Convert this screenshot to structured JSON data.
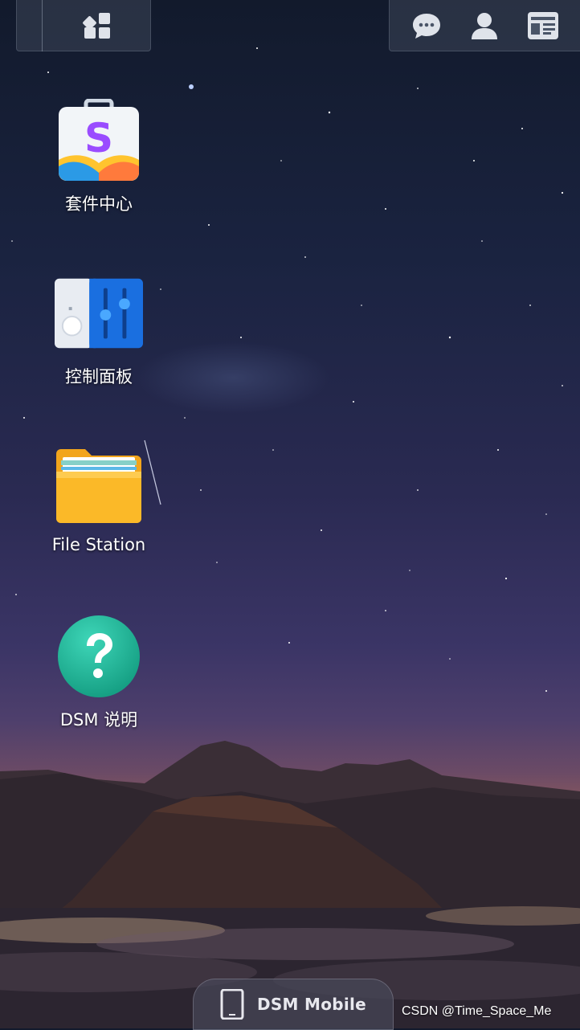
{
  "topbar": {
    "left_icon": "main-menu-grid-icon",
    "right_icons": [
      "chat-bubble-icon",
      "user-icon",
      "widgets-panel-icon"
    ]
  },
  "desktop": {
    "apps": [
      {
        "label": "套件中心",
        "icon": "package-center-icon"
      },
      {
        "label": "控制面板",
        "icon": "control-panel-icon"
      },
      {
        "label": "File Station",
        "icon": "folder-icon"
      },
      {
        "label": "DSM 说明",
        "icon": "help-question-icon"
      }
    ]
  },
  "footer": {
    "mobile_label": "DSM Mobile",
    "mobile_icon": "mobile-device-icon"
  },
  "watermark": "CSDN @Time_Space_Me",
  "colors": {
    "accent_blue": "#1a6fe0",
    "folder_yellow": "#fbb928",
    "help_teal": "#21b89a"
  }
}
